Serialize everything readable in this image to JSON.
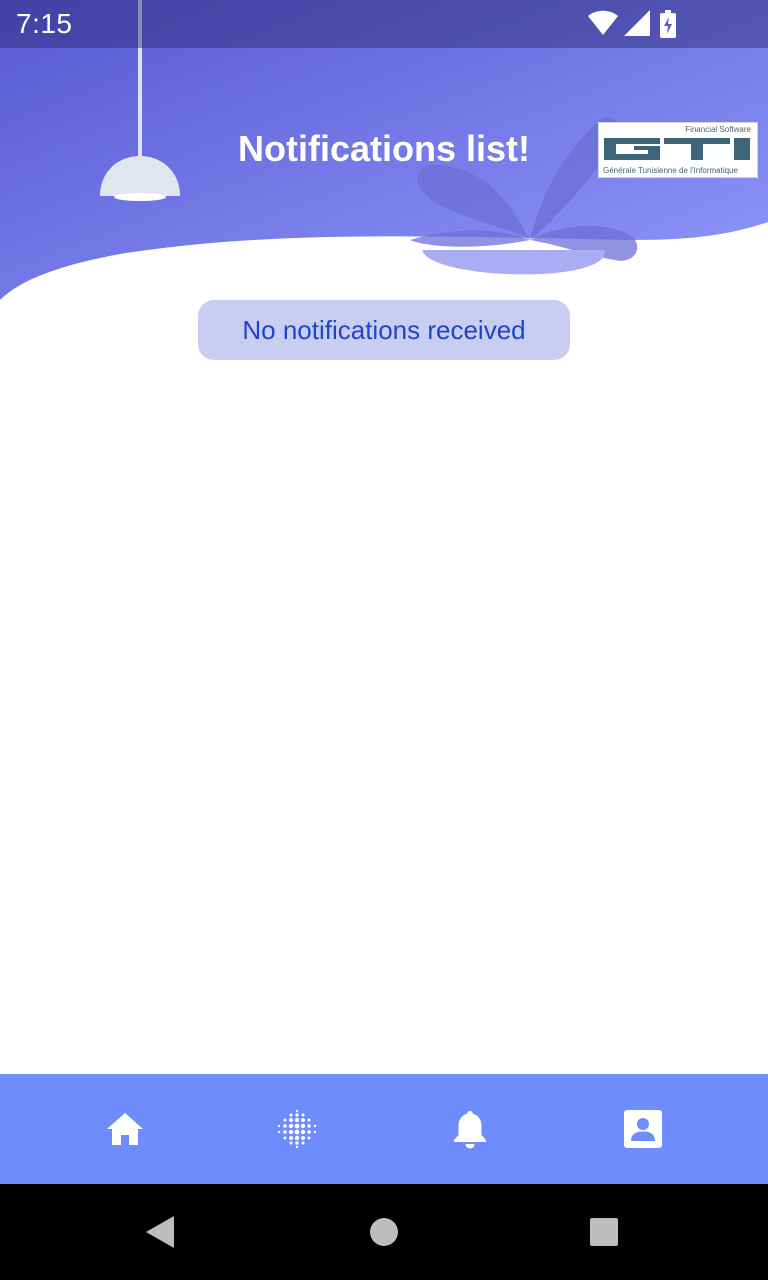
{
  "status_bar": {
    "time": "7:15"
  },
  "header": {
    "title": "Notifications list!"
  },
  "logo": {
    "tagline": "Financial Software",
    "mark": "GTI",
    "company": "Générale Tunisienne de l'Informatique"
  },
  "empty_state": {
    "message": "No notifications received"
  },
  "bottom_nav": {
    "items": [
      {
        "icon": "home-icon"
      },
      {
        "icon": "dots-grid-icon"
      },
      {
        "icon": "bell-icon"
      },
      {
        "icon": "profile-icon"
      }
    ]
  },
  "colors": {
    "header_gradient_start": "#5a5fd6",
    "header_gradient_end": "#8d97fb",
    "chip_bg": "#c8cdf2",
    "chip_text": "#1f44c9",
    "bottom_nav": "#6e8cfb"
  }
}
